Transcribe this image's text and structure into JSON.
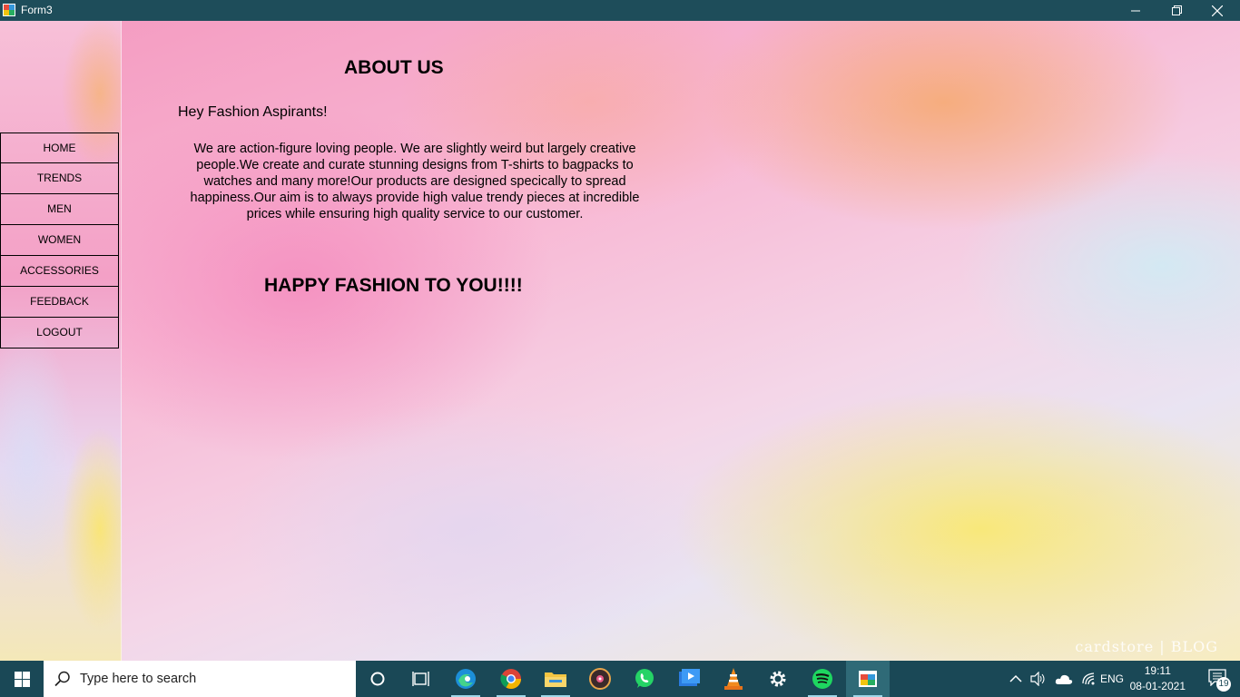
{
  "window": {
    "title": "Form3",
    "controls": [
      "minimize",
      "maximize",
      "close"
    ]
  },
  "nav": {
    "items": [
      "HOME",
      "TRENDS",
      "MEN",
      "WOMEN",
      "ACCESSORIES",
      "FEEDBACK",
      "LOGOUT"
    ]
  },
  "content": {
    "heading": "ABOUT US",
    "greeting": "Hey Fashion Aspirants!",
    "paragraph": "We are action-figure loving people. We are slightly weird but largely creative people.We create and curate stunning designs from T-shirts to bagpacks to watches and many more!Our products are designed specically to spread happiness.Our aim is to always provide high value trendy pieces at incredible prices while ensuring high quality service to our customer.",
    "closing": "HAPPY FASHION TO YOU!!!!",
    "watermark": "cardstore | BLOG"
  },
  "taskbar": {
    "search_placeholder": "Type here to search",
    "apps": [
      "cortana",
      "task-view",
      "edge",
      "chrome",
      "file-explorer",
      "groove-music",
      "whatsapp",
      "video-editor",
      "vlc",
      "settings",
      "spotify",
      "winforms-app"
    ],
    "language": "ENG",
    "time": "19:11",
    "date": "08-01-2021",
    "notification_count": "19"
  },
  "colors": {
    "titlebar": "#1e4d5a",
    "taskbar": "#1a4856"
  }
}
